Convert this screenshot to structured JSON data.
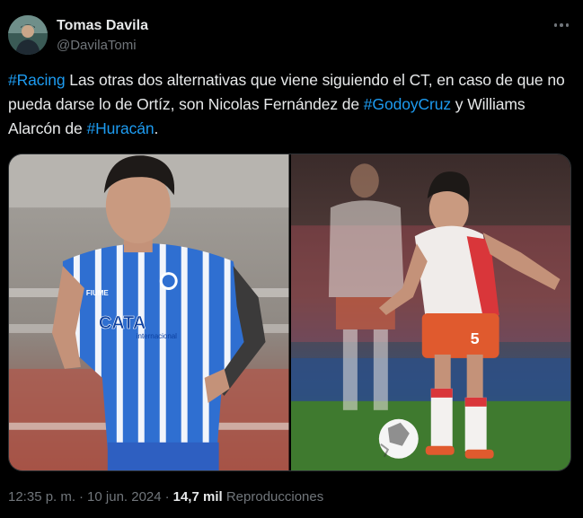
{
  "author": {
    "display_name": "Tomas Davila",
    "handle": "@DavilaTomi"
  },
  "more_icon": "more-horizontal-icon",
  "tweet": {
    "segments": [
      {
        "text": "#Racing",
        "type": "hashtag"
      },
      {
        "text": " Las otras dos alternativas que viene siguiendo el CT, en caso de que no pueda darse lo de Ortíz, son Nicolas Fernández de ",
        "type": "text"
      },
      {
        "text": "#GodoyCruz",
        "type": "hashtag"
      },
      {
        "text": " y Williams Alarcón de ",
        "type": "text"
      },
      {
        "text": "#Huracán",
        "type": "hashtag"
      },
      {
        "text": ".",
        "type": "text"
      }
    ]
  },
  "media": {
    "left_jersey_sponsor": "CATA",
    "left_jersey_sponsor_sub": "internacional",
    "left_jersey_brand": "FIUME",
    "right_shorts_number": "5"
  },
  "meta": {
    "time": "12:35 p. m.",
    "separator": "·",
    "date": "10 jun. 2024",
    "views_count": "14,7 mil",
    "views_label": "Reproducciones"
  },
  "colors": {
    "background": "#000000",
    "text": "#e7e9ea",
    "secondary": "#71767b",
    "hashtag": "#1d9bf0"
  }
}
